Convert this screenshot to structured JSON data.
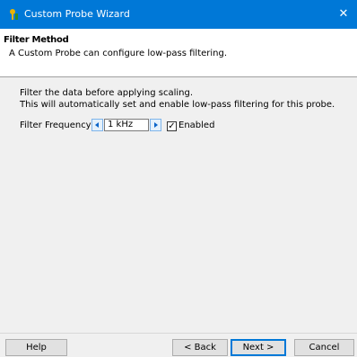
{
  "window": {
    "title": "Custom Probe Wizard",
    "close_glyph": "✕",
    "icon": "probe-app-icon",
    "accent_color": "#0078d7"
  },
  "header": {
    "title": "Filter Method",
    "subtitle": "A Custom Probe can configure low-pass filtering."
  },
  "body": {
    "line1": "Filter the data before applying scaling.",
    "line2": "This will automatically set and enable low-pass filtering for this probe.",
    "filter_label": "Filter Frequency",
    "filter_value": "1 kHz",
    "enabled_checked": true,
    "check_glyph": "✓",
    "enabled_label": "Enabled"
  },
  "buttons": {
    "help": "Help",
    "back": "< Back",
    "next": "Next >",
    "cancel": "Cancel"
  }
}
